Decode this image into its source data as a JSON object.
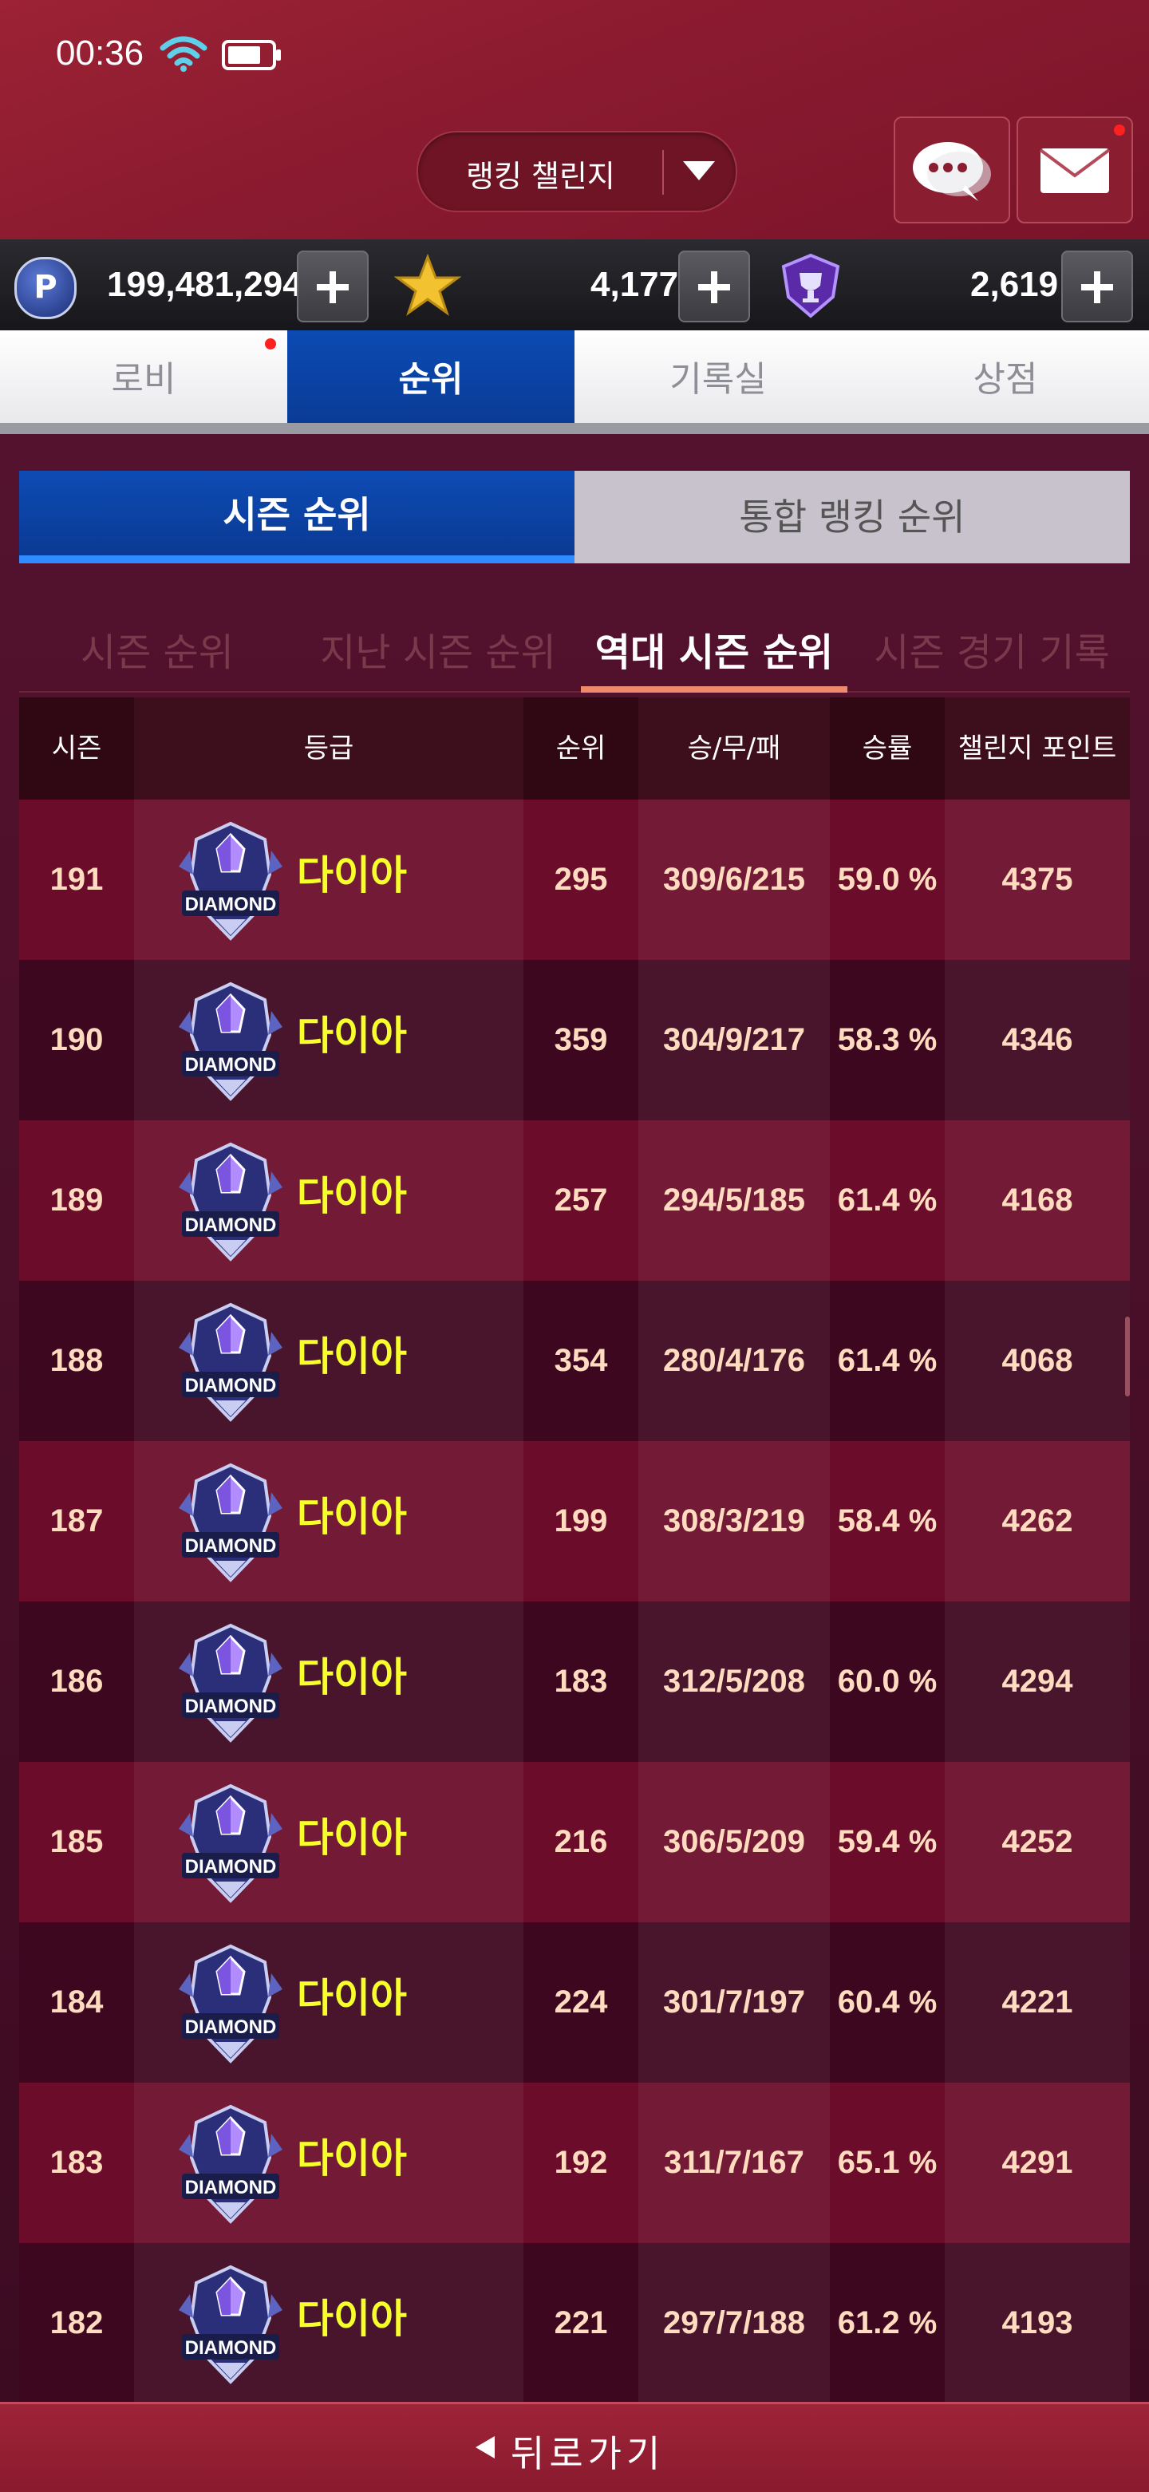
{
  "status_bar": {
    "time": "00:36"
  },
  "header": {
    "mode_label": "랭킹 챌린지"
  },
  "currency": {
    "points": "199,481,294",
    "stars": "4,177",
    "trophies": "2,619",
    "points_icon_letter": "P"
  },
  "main_tabs": [
    {
      "label": "로비",
      "active": false,
      "badge": true
    },
    {
      "label": "순위",
      "active": true
    },
    {
      "label": "기록실",
      "active": false
    },
    {
      "label": "상점",
      "active": false
    }
  ],
  "sub_tabs": [
    {
      "label": "시즌 순위",
      "active": true
    },
    {
      "label": "통합 랭킹 순위",
      "active": false
    }
  ],
  "filters": [
    {
      "label": "시즌 순위",
      "active": false
    },
    {
      "label": "지난 시즌 순위",
      "active": false
    },
    {
      "label": "역대 시즌 순위",
      "active": true
    },
    {
      "label": "시즌 경기 기록",
      "active": false
    }
  ],
  "table": {
    "headers": [
      "시즌",
      "등급",
      "순위",
      "승/무/패",
      "승률",
      "챌린지 포인트"
    ],
    "badge_text": "DIAMOND",
    "rows": [
      {
        "season": "191",
        "grade": "다이아",
        "rank": "295",
        "record": "309/6/215",
        "winrate": "59.0 %",
        "points": "4375"
      },
      {
        "season": "190",
        "grade": "다이아",
        "rank": "359",
        "record": "304/9/217",
        "winrate": "58.3 %",
        "points": "4346"
      },
      {
        "season": "189",
        "grade": "다이아",
        "rank": "257",
        "record": "294/5/185",
        "winrate": "61.4 %",
        "points": "4168"
      },
      {
        "season": "188",
        "grade": "다이아",
        "rank": "354",
        "record": "280/4/176",
        "winrate": "61.4 %",
        "points": "4068"
      },
      {
        "season": "187",
        "grade": "다이아",
        "rank": "199",
        "record": "308/3/219",
        "winrate": "58.4 %",
        "points": "4262"
      },
      {
        "season": "186",
        "grade": "다이아",
        "rank": "183",
        "record": "312/5/208",
        "winrate": "60.0 %",
        "points": "4294"
      },
      {
        "season": "185",
        "grade": "다이아",
        "rank": "216",
        "record": "306/5/209",
        "winrate": "59.4 %",
        "points": "4252"
      },
      {
        "season": "184",
        "grade": "다이아",
        "rank": "224",
        "record": "301/7/197",
        "winrate": "60.4 %",
        "points": "4221"
      },
      {
        "season": "183",
        "grade": "다이아",
        "rank": "192",
        "record": "311/7/167",
        "winrate": "65.1 %",
        "points": "4291"
      },
      {
        "season": "182",
        "grade": "다이아",
        "rank": "221",
        "record": "297/7/188",
        "winrate": "61.2 %",
        "points": "4193"
      }
    ]
  },
  "footer": {
    "back_label": "뒤로가기"
  },
  "colors": {
    "accent_blue": "#0b4ab3",
    "grade_yellow": "#f6ff2a",
    "row_odd": "#6a0c2a",
    "row_even": "#3e0720"
  }
}
